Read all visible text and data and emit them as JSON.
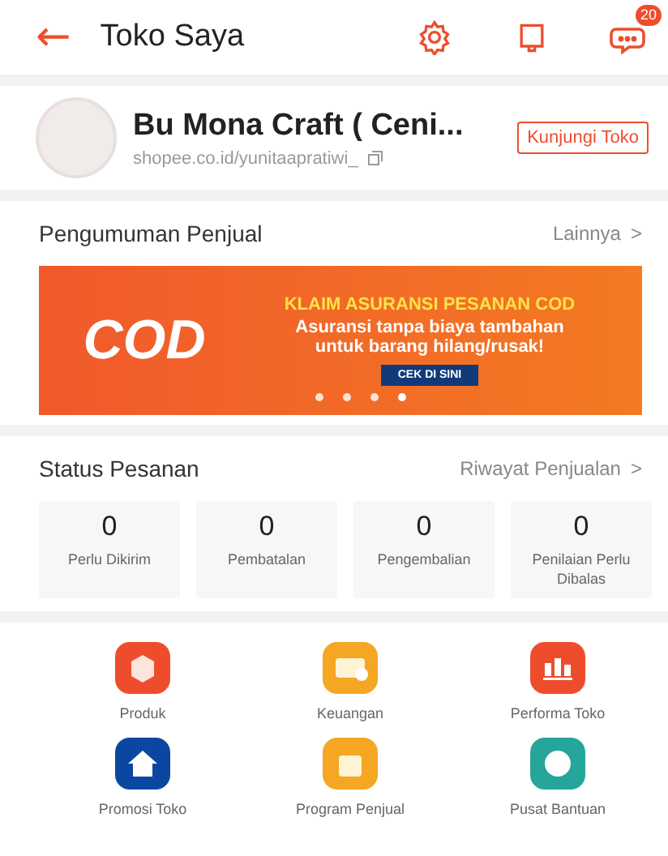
{
  "header": {
    "back": "←",
    "title": "Toko Saya",
    "chat_badge": "20"
  },
  "shop": {
    "name": "Bu Mona Craft ( Ceni...",
    "url": "shopee.co.id/yunitaapratiwi_",
    "visit_button": "Kunjungi Toko"
  },
  "announcement": {
    "title": "Pengumuman Penjual",
    "more": "Lainnya",
    "chevron": ">",
    "banner": {
      "logo": "COD",
      "headline": "KLAIM ASURANSI PESANAN COD",
      "body": "Asuransi tanpa biaya tambahan untuk barang hilang/rusak!",
      "cta": "CEK DI SINI"
    }
  },
  "orders": {
    "title": "Status Pesanan",
    "history": "Riwayat Penjualan",
    "chevron": ">",
    "items": [
      {
        "count": "0",
        "label": "Perlu Dikirim"
      },
      {
        "count": "0",
        "label": "Pembatalan"
      },
      {
        "count": "0",
        "label": "Pengembalian"
      },
      {
        "count": "0",
        "label": "Penilaian Perlu Dibalas"
      }
    ]
  },
  "menu": [
    {
      "label": "Produk",
      "kind": "box",
      "color": "#ee4d2d"
    },
    {
      "label": "Keuangan",
      "kind": "wallet",
      "color": "#f5a623"
    },
    {
      "label": "Performa Toko",
      "kind": "chart",
      "color": "#ee4d2d"
    },
    {
      "label": "Promosi Toko",
      "kind": "promo",
      "color": "#0b47a1"
    },
    {
      "label": "Program Penjual",
      "kind": "bag",
      "color": "#f5a623"
    },
    {
      "label": "Pusat Bantuan",
      "kind": "help",
      "color": "#26a69a"
    }
  ]
}
